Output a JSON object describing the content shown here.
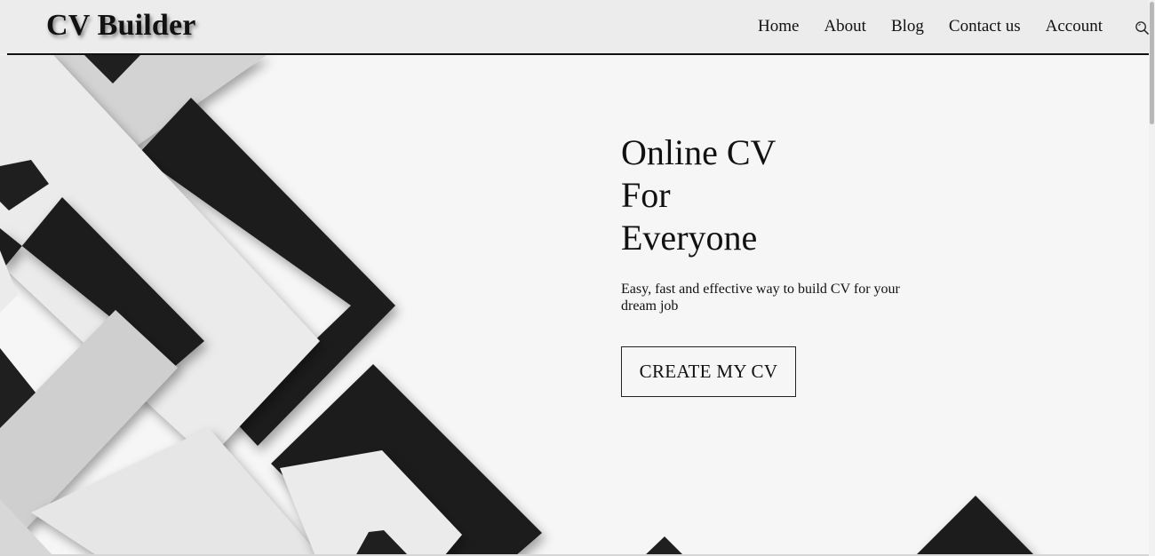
{
  "header": {
    "logo": "CV Builder",
    "nav": [
      {
        "label": "Home"
      },
      {
        "label": "About"
      },
      {
        "label": "Blog"
      },
      {
        "label": "Contact us"
      },
      {
        "label": "Account"
      }
    ],
    "search_icon": "search-icon"
  },
  "hero": {
    "title_lines": [
      "Online CV",
      "For",
      "Everyone"
    ],
    "subtitle": "Easy, fast and effective way to build CV for your dream job",
    "cta_label": "CREATE MY CV"
  },
  "colors": {
    "dark_block": "#1f1f1f",
    "light_block": "#ebebeb",
    "mid_block": "#cfcfcf",
    "background": "#f5f5f5",
    "text": "#111111"
  }
}
